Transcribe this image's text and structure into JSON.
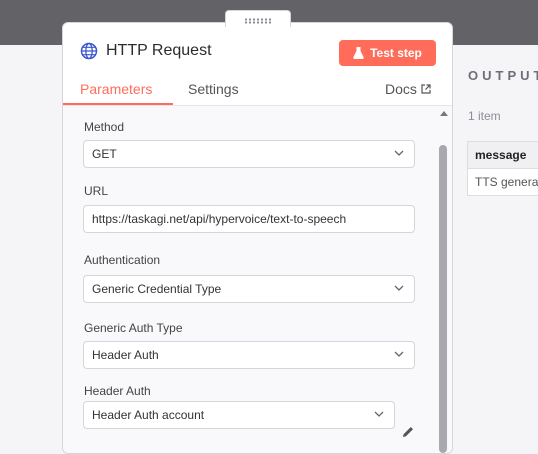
{
  "node": {
    "title": "HTTP Request",
    "test_button": "Test step",
    "icon": "globe-icon"
  },
  "tabs": {
    "parameters": "Parameters",
    "settings": "Settings",
    "docs": "Docs",
    "active": "Parameters"
  },
  "form": {
    "method_label": "Method",
    "method_value": "GET",
    "url_label": "URL",
    "url_value": "https://taskagi.net/api/hypervoice/text-to-speech",
    "auth_label": "Authentication",
    "auth_value": "Generic Credential Type",
    "generic_auth_label": "Generic Auth Type",
    "generic_auth_value": "Header Auth",
    "header_auth_label": "Header Auth",
    "header_auth_value": "Header Auth account"
  },
  "output": {
    "title": "OUTPUT",
    "count": "1 item",
    "column": "message",
    "cell": "TTS genera"
  },
  "colors": {
    "accent": "#ff6d5a",
    "topbar": "#636266"
  }
}
